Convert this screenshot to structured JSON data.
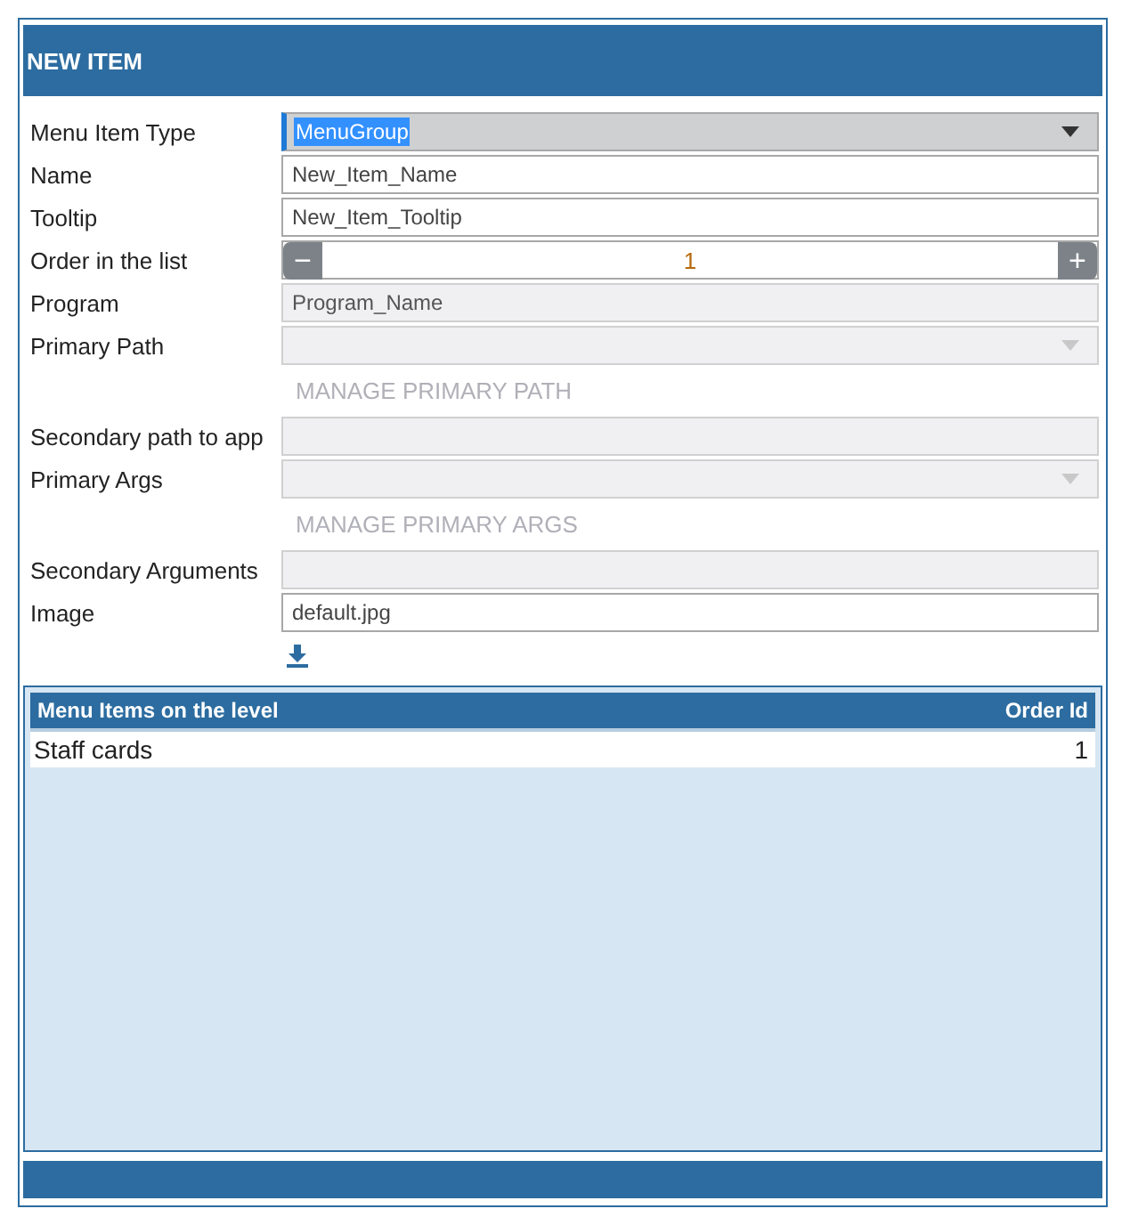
{
  "header": {
    "title": "NEW ITEM"
  },
  "fields": [
    {
      "kind": "select",
      "label": "Menu Item Type",
      "value": "MenuGroup",
      "disabled": false,
      "highlighted": true
    },
    {
      "kind": "text",
      "label": "Name",
      "value": "New_Item_Name",
      "disabled": false
    },
    {
      "kind": "text",
      "label": "Tooltip",
      "value": "New_Item_Tooltip",
      "disabled": false
    },
    {
      "kind": "number",
      "label": "Order in the list",
      "value": "1",
      "minus": "−",
      "plus": "+"
    },
    {
      "kind": "text",
      "label": "Program",
      "value": "Program_Name",
      "disabled": true
    },
    {
      "kind": "select",
      "label": "Primary Path",
      "disabled": true
    },
    {
      "kind": "action",
      "text": "MANAGE PRIMARY PATH",
      "disabled": true
    },
    {
      "kind": "text",
      "label": "Secondary path to app",
      "disabled": true
    },
    {
      "kind": "select",
      "label": "Primary Args",
      "disabled": true
    },
    {
      "kind": "action",
      "text": "MANAGE PRIMARY ARGS",
      "disabled": true
    },
    {
      "kind": "text",
      "label": "Secondary Arguments",
      "disabled": true
    },
    {
      "kind": "text",
      "label": "Image",
      "value": "default.jpg",
      "disabled": false
    },
    {
      "kind": "upload"
    }
  ],
  "table": {
    "columns": [
      "Menu Items on the level",
      "Order Id"
    ],
    "rows": [
      {
        "cells": [
          "Staff cards",
          "1"
        ]
      }
    ]
  }
}
